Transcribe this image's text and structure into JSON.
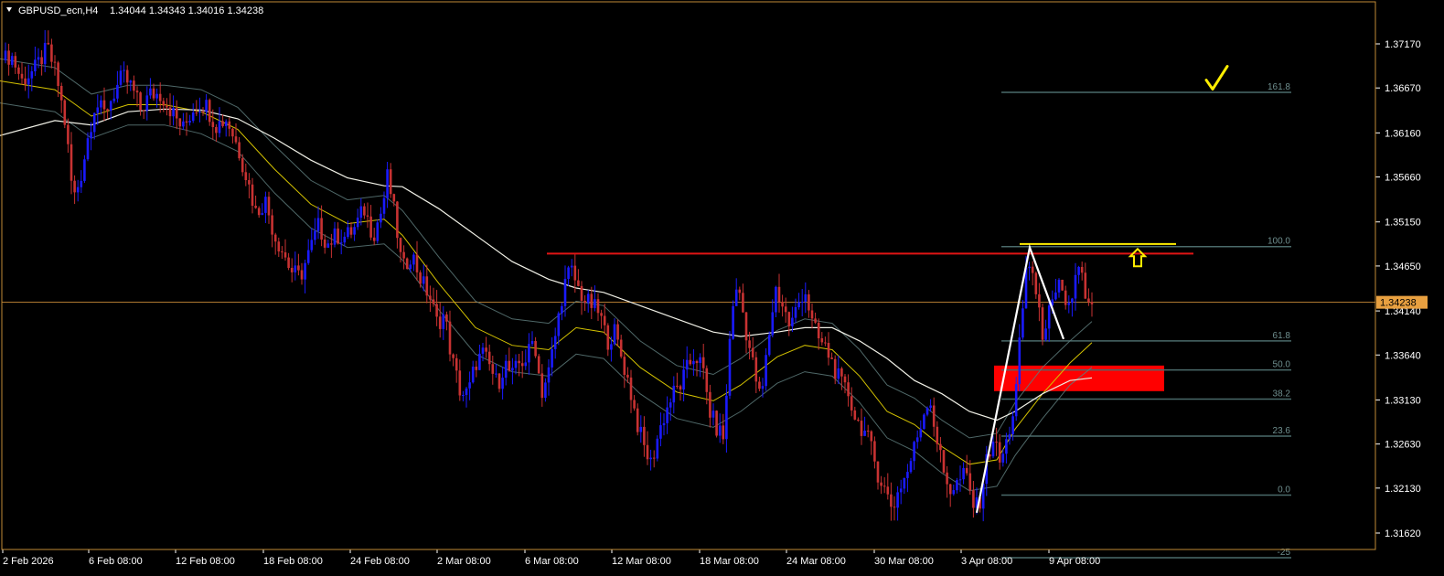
{
  "header": {
    "symbol_tf": "GBPUSD_ecn,H4",
    "ohlc": "1.34044 1.34343 1.34016 1.34238"
  },
  "colors": {
    "background": "#000000",
    "frame": "#c08a36",
    "axis_text": "#ffffff",
    "bull": "#1a1aff",
    "bear": "#c83232",
    "ma_fast": "#d4c200",
    "ma_slow": "#f0f0e6",
    "band": "#5d7a7a",
    "fib": "#4a6a6a",
    "resistance": "#e01414",
    "zone": "#ff0000",
    "marker": "#ffee00",
    "price_label_bg": "#e8a040"
  },
  "chart_data": {
    "type": "candlestick",
    "symbol": "GBPUSD_ecn",
    "timeframe": "H4",
    "ylim": [
      1.3137,
      1.3745
    ],
    "y_ticks": [
      {
        "v": 1.3717,
        "label": "1.37170"
      },
      {
        "v": 1.3667,
        "label": "1.36670"
      },
      {
        "v": 1.3616,
        "label": "1.36160"
      },
      {
        "v": 1.3566,
        "label": "1.35660"
      },
      {
        "v": 1.3515,
        "label": "1.35150"
      },
      {
        "v": 1.3465,
        "label": "1.34650"
      },
      {
        "v": 1.3414,
        "label": "1.34140"
      },
      {
        "v": 1.3364,
        "label": "1.33640"
      },
      {
        "v": 1.3313,
        "label": "1.33130"
      },
      {
        "v": 1.3263,
        "label": "1.32630"
      },
      {
        "v": 1.3213,
        "label": "1.32130"
      },
      {
        "v": 1.3162,
        "label": "1.31620"
      }
    ],
    "x_ticks": [
      "2 Feb 2026",
      "6 Feb 08:00",
      "12 Feb 08:00",
      "18 Feb 08:00",
      "24 Feb 08:00",
      "2 Mar 08:00",
      "6 Mar 08:00",
      "12 Mar 08:00",
      "18 Mar 08:00",
      "24 Mar 08:00",
      "30 Mar 08:00",
      "3 Apr 08:00",
      "9 Apr 08:00"
    ],
    "current_price": {
      "v": 1.34238,
      "label": "1.34238"
    },
    "price_path": [
      [
        0,
        1.3695
      ],
      [
        12,
        1.3705
      ],
      [
        24,
        1.3675
      ],
      [
        38,
        1.3688
      ],
      [
        52,
        1.3712
      ],
      [
        62,
        1.368
      ],
      [
        72,
        1.3622
      ],
      [
        80,
        1.354
      ],
      [
        88,
        1.3565
      ],
      [
        96,
        1.361
      ],
      [
        104,
        1.365
      ],
      [
        114,
        1.3638
      ],
      [
        124,
        1.366
      ],
      [
        134,
        1.368
      ],
      [
        144,
        1.3668
      ],
      [
        154,
        1.3642
      ],
      [
        164,
        1.366
      ],
      [
        176,
        1.366
      ],
      [
        188,
        1.364
      ],
      [
        200,
        1.362
      ],
      [
        212,
        1.3645
      ],
      [
        224,
        1.365
      ],
      [
        236,
        1.3625
      ],
      [
        248,
        1.3632
      ],
      [
        260,
        1.36
      ],
      [
        270,
        1.3565
      ],
      [
        280,
        1.3525
      ],
      [
        290,
        1.354
      ],
      [
        300,
        1.35
      ],
      [
        310,
        1.348
      ],
      [
        318,
        1.346
      ],
      [
        328,
        1.3452
      ],
      [
        338,
        1.348
      ],
      [
        348,
        1.351
      ],
      [
        358,
        1.349
      ],
      [
        368,
        1.35
      ],
      [
        378,
        1.3498
      ],
      [
        388,
        1.3508
      ],
      [
        398,
        1.353
      ],
      [
        408,
        1.35
      ],
      [
        418,
        1.353
      ],
      [
        424,
        1.3568
      ],
      [
        432,
        1.352
      ],
      [
        440,
        1.346
      ],
      [
        450,
        1.348
      ],
      [
        460,
        1.345
      ],
      [
        470,
        1.343
      ],
      [
        478,
        1.34
      ],
      [
        486,
        1.341
      ],
      [
        494,
        1.336
      ],
      [
        504,
        1.332
      ],
      [
        512,
        1.332
      ],
      [
        520,
        1.3355
      ],
      [
        528,
        1.3365
      ],
      [
        536,
        1.335
      ],
      [
        544,
        1.333
      ],
      [
        552,
        1.3355
      ],
      [
        560,
        1.334
      ],
      [
        568,
        1.3355
      ],
      [
        576,
        1.336
      ],
      [
        584,
        1.3385
      ],
      [
        592,
        1.332
      ],
      [
        600,
        1.3345
      ],
      [
        608,
        1.339
      ],
      [
        616,
        1.344
      ],
      [
        624,
        1.3462
      ],
      [
        632,
        1.344
      ],
      [
        640,
        1.3425
      ],
      [
        648,
        1.342
      ],
      [
        656,
        1.341
      ],
      [
        664,
        1.338
      ],
      [
        672,
        1.339
      ],
      [
        680,
        1.336
      ],
      [
        688,
        1.333
      ],
      [
        696,
        1.329
      ],
      [
        704,
        1.326
      ],
      [
        712,
        1.324
      ],
      [
        720,
        1.3275
      ],
      [
        728,
        1.33
      ],
      [
        736,
        1.332
      ],
      [
        744,
        1.333
      ],
      [
        752,
        1.335
      ],
      [
        760,
        1.3365
      ],
      [
        768,
        1.335
      ],
      [
        776,
        1.33
      ],
      [
        784,
        1.328
      ],
      [
        792,
        1.327
      ],
      [
        800,
        1.342
      ],
      [
        808,
        1.344
      ],
      [
        816,
        1.339
      ],
      [
        824,
        1.335
      ],
      [
        832,
        1.331
      ],
      [
        840,
        1.338
      ],
      [
        848,
        1.344
      ],
      [
        856,
        1.342
      ],
      [
        864,
        1.3395
      ],
      [
        872,
        1.342
      ],
      [
        880,
        1.344
      ],
      [
        888,
        1.34
      ],
      [
        896,
        1.338
      ],
      [
        904,
        1.337
      ],
      [
        912,
        1.335
      ],
      [
        920,
        1.333
      ],
      [
        928,
        1.332
      ],
      [
        936,
        1.329
      ],
      [
        944,
        1.328
      ],
      [
        952,
        1.326
      ],
      [
        960,
        1.323
      ],
      [
        968,
        1.321
      ],
      [
        976,
        1.319
      ],
      [
        984,
        1.3215
      ],
      [
        992,
        1.323
      ],
      [
        1000,
        1.326
      ],
      [
        1008,
        1.329
      ],
      [
        1016,
        1.332
      ],
      [
        1024,
        1.327
      ],
      [
        1032,
        1.323
      ],
      [
        1040,
        1.321
      ],
      [
        1048,
        1.322
      ],
      [
        1056,
        1.323
      ],
      [
        1064,
        1.3195
      ],
      [
        1070,
        1.319
      ],
      [
        1078,
        1.324
      ],
      [
        1086,
        1.327
      ],
      [
        1094,
        1.324
      ],
      [
        1102,
        1.327
      ],
      [
        1110,
        1.331
      ],
      [
        1116,
        1.339
      ],
      [
        1122,
        1.346
      ],
      [
        1128,
        1.347
      ],
      [
        1134,
        1.342
      ],
      [
        1140,
        1.339
      ],
      [
        1146,
        1.341
      ],
      [
        1152,
        1.342
      ],
      [
        1158,
        1.344
      ],
      [
        1164,
        1.3425
      ],
      [
        1170,
        1.342
      ],
      [
        1176,
        1.345
      ],
      [
        1182,
        1.3465
      ],
      [
        1188,
        1.341
      ],
      [
        1194,
        1.3424
      ]
    ],
    "indicators": [
      {
        "name": "ma_fast",
        "color": "#d4c200",
        "points": [
          [
            0,
            1.3675
          ],
          [
            60,
            1.3665
          ],
          [
            100,
            1.3635
          ],
          [
            140,
            1.3648
          ],
          [
            180,
            1.3648
          ],
          [
            220,
            1.364
          ],
          [
            260,
            1.362
          ],
          [
            300,
            1.3575
          ],
          [
            340,
            1.3535
          ],
          [
            380,
            1.3513
          ],
          [
            420,
            1.3518
          ],
          [
            440,
            1.35
          ],
          [
            480,
            1.3445
          ],
          [
            520,
            1.3395
          ],
          [
            560,
            1.3375
          ],
          [
            600,
            1.337
          ],
          [
            630,
            1.3395
          ],
          [
            660,
            1.339
          ],
          [
            700,
            1.335
          ],
          [
            740,
            1.3322
          ],
          [
            780,
            1.3312
          ],
          [
            810,
            1.333
          ],
          [
            850,
            1.3362
          ],
          [
            880,
            1.3375
          ],
          [
            910,
            1.337
          ],
          [
            940,
            1.334
          ],
          [
            970,
            1.33
          ],
          [
            1000,
            1.3285
          ],
          [
            1030,
            1.326
          ],
          [
            1060,
            1.324
          ],
          [
            1090,
            1.3245
          ],
          [
            1110,
            1.328
          ],
          [
            1140,
            1.332
          ],
          [
            1170,
            1.3355
          ],
          [
            1194,
            1.3378
          ]
        ]
      },
      {
        "name": "band_upper",
        "color": "#5d7a7a",
        "points": [
          [
            0,
            1.37
          ],
          [
            60,
            1.369
          ],
          [
            100,
            1.366
          ],
          [
            140,
            1.367
          ],
          [
            180,
            1.367
          ],
          [
            220,
            1.3665
          ],
          [
            260,
            1.3645
          ],
          [
            300,
            1.3602
          ],
          [
            340,
            1.3562
          ],
          [
            380,
            1.354
          ],
          [
            420,
            1.3545
          ],
          [
            440,
            1.3528
          ],
          [
            480,
            1.3475
          ],
          [
            520,
            1.3425
          ],
          [
            560,
            1.3405
          ],
          [
            600,
            1.34
          ],
          [
            630,
            1.3425
          ],
          [
            660,
            1.342
          ],
          [
            700,
            1.338
          ],
          [
            740,
            1.3352
          ],
          [
            780,
            1.3342
          ],
          [
            810,
            1.336
          ],
          [
            850,
            1.3392
          ],
          [
            880,
            1.3405
          ],
          [
            910,
            1.34
          ],
          [
            940,
            1.337
          ],
          [
            970,
            1.333
          ],
          [
            1000,
            1.3315
          ],
          [
            1030,
            1.329
          ],
          [
            1060,
            1.327
          ],
          [
            1090,
            1.3275
          ],
          [
            1110,
            1.331
          ],
          [
            1140,
            1.335
          ],
          [
            1170,
            1.338
          ],
          [
            1194,
            1.3402
          ]
        ]
      },
      {
        "name": "band_lower",
        "color": "#5d7a7a",
        "points": [
          [
            0,
            1.365
          ],
          [
            60,
            1.364
          ],
          [
            100,
            1.361
          ],
          [
            140,
            1.3625
          ],
          [
            180,
            1.3625
          ],
          [
            220,
            1.3615
          ],
          [
            260,
            1.3595
          ],
          [
            300,
            1.3548
          ],
          [
            340,
            1.3508
          ],
          [
            380,
            1.3486
          ],
          [
            420,
            1.349
          ],
          [
            440,
            1.3472
          ],
          [
            480,
            1.3415
          ],
          [
            520,
            1.3365
          ],
          [
            560,
            1.3345
          ],
          [
            600,
            1.334
          ],
          [
            630,
            1.3365
          ],
          [
            660,
            1.336
          ],
          [
            700,
            1.332
          ],
          [
            740,
            1.3292
          ],
          [
            780,
            1.3282
          ],
          [
            810,
            1.33
          ],
          [
            850,
            1.3332
          ],
          [
            880,
            1.3345
          ],
          [
            910,
            1.334
          ],
          [
            940,
            1.331
          ],
          [
            970,
            1.327
          ],
          [
            1000,
            1.3255
          ],
          [
            1030,
            1.323
          ],
          [
            1060,
            1.321
          ],
          [
            1090,
            1.3215
          ],
          [
            1110,
            1.325
          ],
          [
            1140,
            1.3292
          ],
          [
            1170,
            1.333
          ],
          [
            1194,
            1.335
          ]
        ]
      },
      {
        "name": "ma_slow",
        "color": "#f0f0e6",
        "points": [
          [
            0,
            1.3613
          ],
          [
            60,
            1.363
          ],
          [
            100,
            1.3625
          ],
          [
            140,
            1.364
          ],
          [
            180,
            1.3643
          ],
          [
            220,
            1.3642
          ],
          [
            260,
            1.3632
          ],
          [
            300,
            1.361
          ],
          [
            340,
            1.3585
          ],
          [
            380,
            1.3565
          ],
          [
            420,
            1.3556
          ],
          [
            440,
            1.3555
          ],
          [
            480,
            1.353
          ],
          [
            520,
            1.35
          ],
          [
            560,
            1.347
          ],
          [
            600,
            1.345
          ],
          [
            630,
            1.344
          ],
          [
            660,
            1.3435
          ],
          [
            700,
            1.342
          ],
          [
            740,
            1.3405
          ],
          [
            780,
            1.339
          ],
          [
            810,
            1.3385
          ],
          [
            850,
            1.339
          ],
          [
            880,
            1.3395
          ],
          [
            910,
            1.3395
          ],
          [
            940,
            1.338
          ],
          [
            970,
            1.336
          ],
          [
            1000,
            1.3335
          ],
          [
            1030,
            1.332
          ],
          [
            1060,
            1.33
          ],
          [
            1090,
            1.329
          ],
          [
            1110,
            1.33
          ],
          [
            1140,
            1.332
          ],
          [
            1170,
            1.3335
          ],
          [
            1194,
            1.3338
          ]
        ]
      }
    ],
    "fibonacci": {
      "x1": 1095,
      "x2": 1412,
      "levels": [
        {
          "label": "161.8",
          "v": 1.3662
        },
        {
          "label": "100.0",
          "v": 1.3487
        },
        {
          "label": "61.8",
          "v": 1.338
        },
        {
          "label": "50.0",
          "v": 1.3347
        },
        {
          "label": "38.2",
          "v": 1.3314
        },
        {
          "label": "23.6",
          "v": 1.3272
        },
        {
          "label": "0.0",
          "v": 1.3205
        },
        {
          "label": "-25",
          "v": 1.3134
        }
      ]
    },
    "resistance_line": {
      "x1": 598,
      "x2": 1305,
      "v": 1.3479
    },
    "supply_zone": {
      "x1": 1087,
      "x2": 1273,
      "v_top": 1.3352,
      "v_bottom": 1.3323
    },
    "swing_lines": [
      {
        "points": [
          [
            1068,
            1.3185
          ],
          [
            1126,
            1.3486
          ],
          [
            1163,
            1.3382
          ]
        ]
      }
    ],
    "target_line": {
      "x1": 1115,
      "x2": 1286,
      "v": 1.349
    },
    "arrow_marker": {
      "x": 1244,
      "v": 1.3475
    },
    "checkmark": {
      "x": 1330,
      "v": 1.3677
    }
  }
}
